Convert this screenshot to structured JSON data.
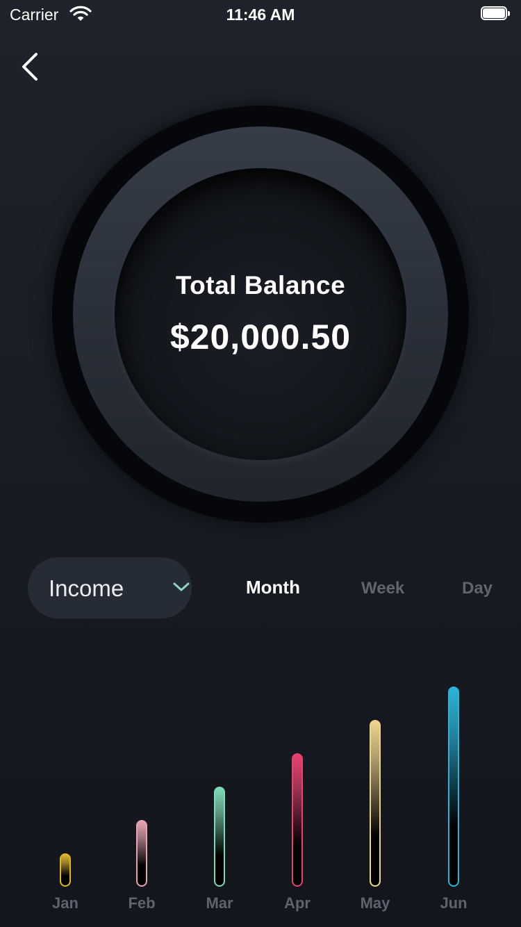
{
  "status_bar": {
    "carrier": "Carrier",
    "time": "11:46 AM",
    "wifi_icon": "wifi-icon",
    "battery_icon": "battery-icon"
  },
  "nav": {
    "back_icon": "chevron-left-icon"
  },
  "balance": {
    "title": "Total Balance",
    "amount": "$20,000.50"
  },
  "filter": {
    "selected": "Income",
    "dropdown_icon": "chevron-down-icon"
  },
  "periods": [
    {
      "label": "Month",
      "active": true
    },
    {
      "label": "Week",
      "active": false
    },
    {
      "label": "Day",
      "active": false
    }
  ],
  "chart_data": {
    "type": "bar",
    "categories": [
      "Jan",
      "Feb",
      "Mar",
      "Apr",
      "May",
      "Jun"
    ],
    "values": [
      1,
      2,
      3,
      4,
      5,
      6
    ],
    "colors": [
      "#e0b72c",
      "#e8a4b0",
      "#7fd9b8",
      "#e8426f",
      "#eed48c",
      "#2bb4d8"
    ],
    "ylim": [
      0,
      6
    ],
    "grid": false,
    "legend": "none"
  }
}
